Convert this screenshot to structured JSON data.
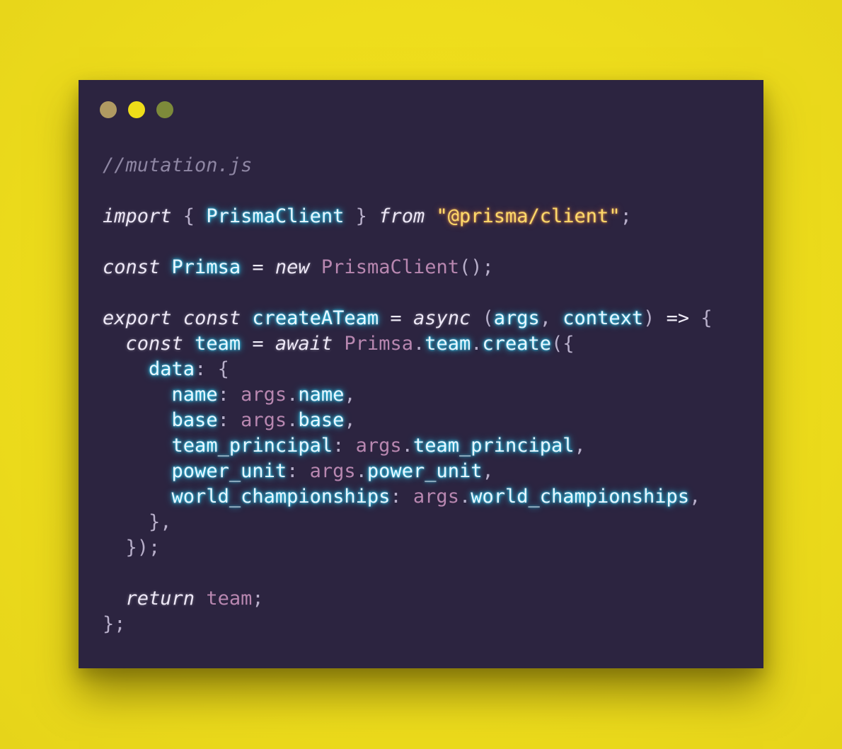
{
  "window": {
    "controls": {
      "close_color": "#b09a62",
      "minimize_color": "#eedd19",
      "maximize_color": "#7d8a3a"
    }
  },
  "colors": {
    "background": "#eedd1c",
    "editor_background": "#2c2440",
    "comment": "#8e86a3",
    "keyword": "#ede7f6",
    "identifier": "#e8f6ff",
    "identifier_glow": "#2fd9ff",
    "string": "#ffd96a",
    "plain": "#b887b0",
    "punctuation": "#b7aec9"
  },
  "code": {
    "lines": [
      [
        {
          "t": "//mutation.js",
          "c": "comment"
        }
      ],
      [],
      [
        {
          "t": "import",
          "c": "kw"
        },
        {
          "t": " { ",
          "c": "punc"
        },
        {
          "t": "PrismaClient",
          "c": "id"
        },
        {
          "t": " } ",
          "c": "punc"
        },
        {
          "t": "from",
          "c": "kw"
        },
        {
          "t": " ",
          "c": "punc"
        },
        {
          "t": "\"@prisma/client\"",
          "c": "str"
        },
        {
          "t": ";",
          "c": "punc"
        }
      ],
      [],
      [
        {
          "t": "const",
          "c": "kw"
        },
        {
          "t": " ",
          "c": "punc"
        },
        {
          "t": "Primsa",
          "c": "id"
        },
        {
          "t": " = ",
          "c": "op"
        },
        {
          "t": "new",
          "c": "kw"
        },
        {
          "t": " ",
          "c": "punc"
        },
        {
          "t": "PrismaClient",
          "c": "pl"
        },
        {
          "t": "();",
          "c": "punc"
        }
      ],
      [],
      [
        {
          "t": "export",
          "c": "kw"
        },
        {
          "t": " ",
          "c": "punc"
        },
        {
          "t": "const",
          "c": "kw"
        },
        {
          "t": " ",
          "c": "punc"
        },
        {
          "t": "createATeam",
          "c": "id"
        },
        {
          "t": " = ",
          "c": "op"
        },
        {
          "t": "async",
          "c": "kw"
        },
        {
          "t": " (",
          "c": "punc"
        },
        {
          "t": "args",
          "c": "id"
        },
        {
          "t": ", ",
          "c": "punc"
        },
        {
          "t": "context",
          "c": "id"
        },
        {
          "t": ") ",
          "c": "punc"
        },
        {
          "t": "=>",
          "c": "op"
        },
        {
          "t": " {",
          "c": "punc"
        }
      ],
      [
        {
          "t": "  ",
          "c": "punc"
        },
        {
          "t": "const",
          "c": "kw"
        },
        {
          "t": " ",
          "c": "punc"
        },
        {
          "t": "team",
          "c": "id"
        },
        {
          "t": " = ",
          "c": "op"
        },
        {
          "t": "await",
          "c": "kw"
        },
        {
          "t": " ",
          "c": "punc"
        },
        {
          "t": "Primsa",
          "c": "pl"
        },
        {
          "t": ".",
          "c": "punc"
        },
        {
          "t": "team",
          "c": "id"
        },
        {
          "t": ".",
          "c": "punc"
        },
        {
          "t": "create",
          "c": "id"
        },
        {
          "t": "({",
          "c": "punc"
        }
      ],
      [
        {
          "t": "    ",
          "c": "punc"
        },
        {
          "t": "data",
          "c": "id"
        },
        {
          "t": ": {",
          "c": "punc"
        }
      ],
      [
        {
          "t": "      ",
          "c": "punc"
        },
        {
          "t": "name",
          "c": "id"
        },
        {
          "t": ": ",
          "c": "punc"
        },
        {
          "t": "args",
          "c": "pl"
        },
        {
          "t": ".",
          "c": "punc"
        },
        {
          "t": "name",
          "c": "id"
        },
        {
          "t": ",",
          "c": "punc"
        }
      ],
      [
        {
          "t": "      ",
          "c": "punc"
        },
        {
          "t": "base",
          "c": "id"
        },
        {
          "t": ": ",
          "c": "punc"
        },
        {
          "t": "args",
          "c": "pl"
        },
        {
          "t": ".",
          "c": "punc"
        },
        {
          "t": "base",
          "c": "id"
        },
        {
          "t": ",",
          "c": "punc"
        }
      ],
      [
        {
          "t": "      ",
          "c": "punc"
        },
        {
          "t": "team_principal",
          "c": "id"
        },
        {
          "t": ": ",
          "c": "punc"
        },
        {
          "t": "args",
          "c": "pl"
        },
        {
          "t": ".",
          "c": "punc"
        },
        {
          "t": "team_principal",
          "c": "id"
        },
        {
          "t": ",",
          "c": "punc"
        }
      ],
      [
        {
          "t": "      ",
          "c": "punc"
        },
        {
          "t": "power_unit",
          "c": "id"
        },
        {
          "t": ": ",
          "c": "punc"
        },
        {
          "t": "args",
          "c": "pl"
        },
        {
          "t": ".",
          "c": "punc"
        },
        {
          "t": "power_unit",
          "c": "id"
        },
        {
          "t": ",",
          "c": "punc"
        }
      ],
      [
        {
          "t": "      ",
          "c": "punc"
        },
        {
          "t": "world_championships",
          "c": "id"
        },
        {
          "t": ": ",
          "c": "punc"
        },
        {
          "t": "args",
          "c": "pl"
        },
        {
          "t": ".",
          "c": "punc"
        },
        {
          "t": "world_championships",
          "c": "id"
        },
        {
          "t": ",",
          "c": "punc"
        }
      ],
      [
        {
          "t": "    },",
          "c": "punc"
        }
      ],
      [
        {
          "t": "  });",
          "c": "punc"
        }
      ],
      [],
      [
        {
          "t": "  ",
          "c": "punc"
        },
        {
          "t": "return",
          "c": "kw"
        },
        {
          "t": " ",
          "c": "punc"
        },
        {
          "t": "team",
          "c": "pl"
        },
        {
          "t": ";",
          "c": "punc"
        }
      ],
      [
        {
          "t": "};",
          "c": "punc"
        }
      ]
    ]
  }
}
